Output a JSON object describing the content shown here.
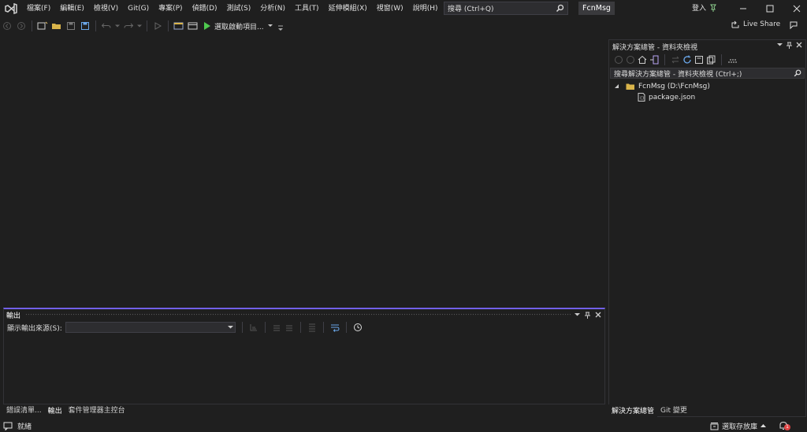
{
  "menubar": {
    "items": [
      {
        "id": "file",
        "label": "檔案(F)"
      },
      {
        "id": "edit",
        "label": "編輯(E)"
      },
      {
        "id": "view",
        "label": "檢視(V)"
      },
      {
        "id": "git",
        "label": "Git(G)"
      },
      {
        "id": "project",
        "label": "專案(P)"
      },
      {
        "id": "debug",
        "label": "偵錯(D)"
      },
      {
        "id": "test",
        "label": "測試(S)"
      },
      {
        "id": "analyze",
        "label": "分析(N)"
      },
      {
        "id": "tools",
        "label": "工具(T)"
      },
      {
        "id": "extensions",
        "label": "延伸模組(X)"
      },
      {
        "id": "window",
        "label": "視窗(W)"
      },
      {
        "id": "help",
        "label": "說明(H)"
      }
    ],
    "search_placeholder": "搜尋 (Ctrl+Q)",
    "solution_name": "FcnMsg",
    "signin_label": "登入"
  },
  "toolbar": {
    "start_label": "選取啟動項目..."
  },
  "liveshare": {
    "label": "Live Share"
  },
  "solution_explorer": {
    "title": "解決方案總管 - 資料夾檢視",
    "search_placeholder": "搜尋解決方案總管 - 資料夾檢視 (Ctrl+;)",
    "tree": {
      "root_label": "FcnMsg (D:\\FcnMsg)",
      "children": [
        "package.json"
      ]
    },
    "tabs": [
      "解決方案總管",
      "Git 變更"
    ]
  },
  "output": {
    "title": "輸出",
    "source_label": "顯示輸出來源(S):",
    "source_value": "",
    "tabs": [
      "錯誤清單...",
      "輸出",
      "套件管理器主控台"
    ]
  },
  "statusbar": {
    "ready": "就緒",
    "repo_label": "選取存放庫",
    "notifications_count": "1"
  },
  "colors": {
    "accent": "#7160e8",
    "background": "#1f1f1f",
    "vs_logo": "#b9a6f5",
    "run_green": "#4ec94e"
  }
}
